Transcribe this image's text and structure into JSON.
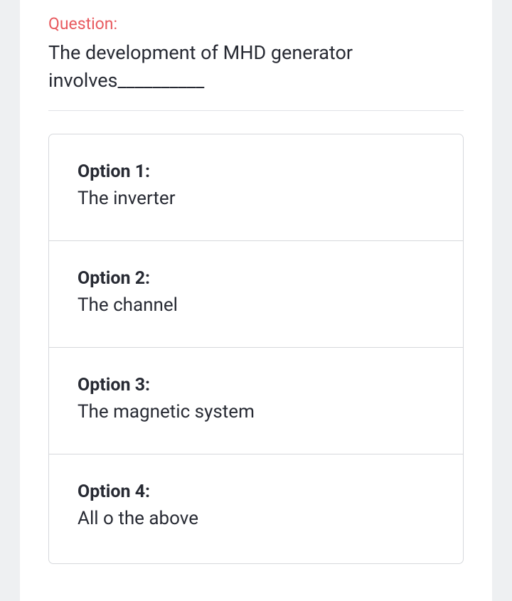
{
  "question": {
    "label": "Question:",
    "text": "The development of MHD generator involves__________"
  },
  "options": [
    {
      "label": "Option 1:",
      "text": "The inverter"
    },
    {
      "label": "Option 2:",
      "text": "The channel"
    },
    {
      "label": "Option 3:",
      "text": "The magnetic system"
    },
    {
      "label": "Option 4:",
      "text": "All o the above"
    }
  ]
}
